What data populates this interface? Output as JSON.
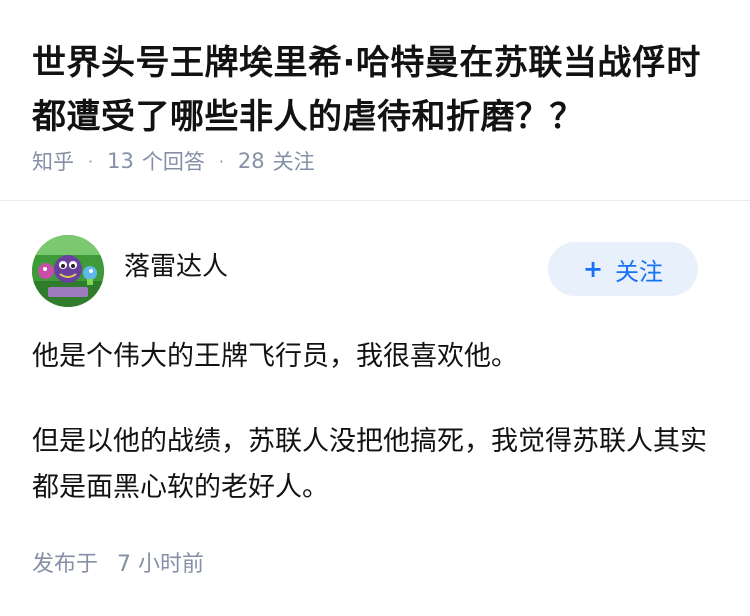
{
  "question": {
    "title": "世界头号王牌埃里希·哈特曼在苏联当战俘时都遭受了哪些非人的虐待和折磨？？",
    "source": "知乎",
    "answer_count": "13",
    "answer_label": "个回答",
    "follower_count": "28",
    "follower_label": "关注",
    "separator": "·"
  },
  "answer": {
    "author": {
      "name": "落雷达人",
      "avatar_icon": "pvz-plants-avatar-icon"
    },
    "follow_button": {
      "plus": "+",
      "label": "关注"
    },
    "paragraphs": [
      "他是个伟大的王牌飞行员，我很喜欢他。",
      "但是以他的战绩，苏联人没把他搞死，我觉得苏联人其实都是面黑心软的老好人。"
    ],
    "publish": {
      "label": "发布于",
      "time": "7 小时前"
    }
  },
  "colors": {
    "text": "#121212",
    "meta": "#8590a6",
    "brand_blue": "#1772f6",
    "follow_bg": "#e8f1fb",
    "divider": "#ebebeb"
  }
}
